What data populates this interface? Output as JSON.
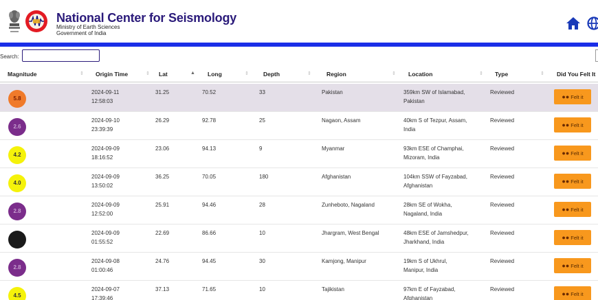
{
  "header": {
    "title": "National Center for Seismology",
    "ministry": "Ministry of Earth Sciences",
    "government": "Government of India",
    "icons": [
      "emblem-icon",
      "ncs-logo-icon",
      "home-icon",
      "globe-icon"
    ]
  },
  "search": {
    "label": "Search:",
    "value": "",
    "placeholder": ""
  },
  "table": {
    "columns": [
      "Magnitude",
      "Origin Time",
      "Lat",
      "Long",
      "Depth",
      "Region",
      "Location",
      "Type",
      "Did You Felt It"
    ],
    "felt_label": "Felt it",
    "rows": [
      {
        "mag": "5.8",
        "color": "#f07a2a",
        "date": "2024-09-11",
        "time": "12:58:03",
        "lat": "31.25",
        "long": "70.52",
        "depth": "33",
        "region": "Pakistan",
        "loc1": "359km SW of Islamabad,",
        "loc2": "Pakistan",
        "type": "Reviewed"
      },
      {
        "mag": "2.6",
        "color": "#7b2d8b",
        "date": "2024-09-10",
        "time": "23:39:39",
        "lat": "26.29",
        "long": "92.78",
        "depth": "25",
        "region": "Nagaon, Assam",
        "loc1": "40km S of Tezpur, Assam,",
        "loc2": "India",
        "type": "Reviewed"
      },
      {
        "mag": "4.2",
        "color": "#f5f20a",
        "date": "2024-09-09",
        "time": "18:16:52",
        "lat": "23.06",
        "long": "94.13",
        "depth": "9",
        "region": "Myanmar",
        "loc1": "93km ESE of Champhai,",
        "loc2": "Mizoram, India",
        "type": "Reviewed"
      },
      {
        "mag": "4.0",
        "color": "#f5f20a",
        "date": "2024-09-09",
        "time": "13:50:02",
        "lat": "36.25",
        "long": "70.05",
        "depth": "180",
        "region": "Afghanistan",
        "loc1": "104km SSW of Fayzabad,",
        "loc2": "Afghanistan",
        "type": "Reviewed"
      },
      {
        "mag": "2.8",
        "color": "#7b2d8b",
        "date": "2024-09-09",
        "time": "12:52:00",
        "lat": "25.91",
        "long": "94.46",
        "depth": "28",
        "region": "Zunheboto, Nagaland",
        "loc1": "28km SE of Wokha,",
        "loc2": "Nagaland, India",
        "type": "Reviewed"
      },
      {
        "mag": "",
        "color": "#1a1a1a",
        "date": "2024-09-09",
        "time": "01:55:52",
        "lat": "22.69",
        "long": "86.66",
        "depth": "10",
        "region": "Jhargram, West Bengal",
        "loc1": "48km ESE of Jamshedpur,",
        "loc2": "Jharkhand, India",
        "type": "Reviewed"
      },
      {
        "mag": "2.8",
        "color": "#7b2d8b",
        "date": "2024-09-08",
        "time": "01:00:46",
        "lat": "24.76",
        "long": "94.45",
        "depth": "30",
        "region": "Kamjong, Manipur",
        "loc1": "19km S of Ukhrul,",
        "loc2": "Manipur, India",
        "type": "Reviewed"
      },
      {
        "mag": "4.5",
        "color": "#f5f20a",
        "date": "2024-09-07",
        "time": "17:39:46",
        "lat": "37.13",
        "long": "71.65",
        "depth": "10",
        "region": "Tajikistan",
        "loc1": "97km E of Fayzabad,",
        "loc2": "Afghanistan",
        "type": "Reviewed"
      }
    ]
  }
}
